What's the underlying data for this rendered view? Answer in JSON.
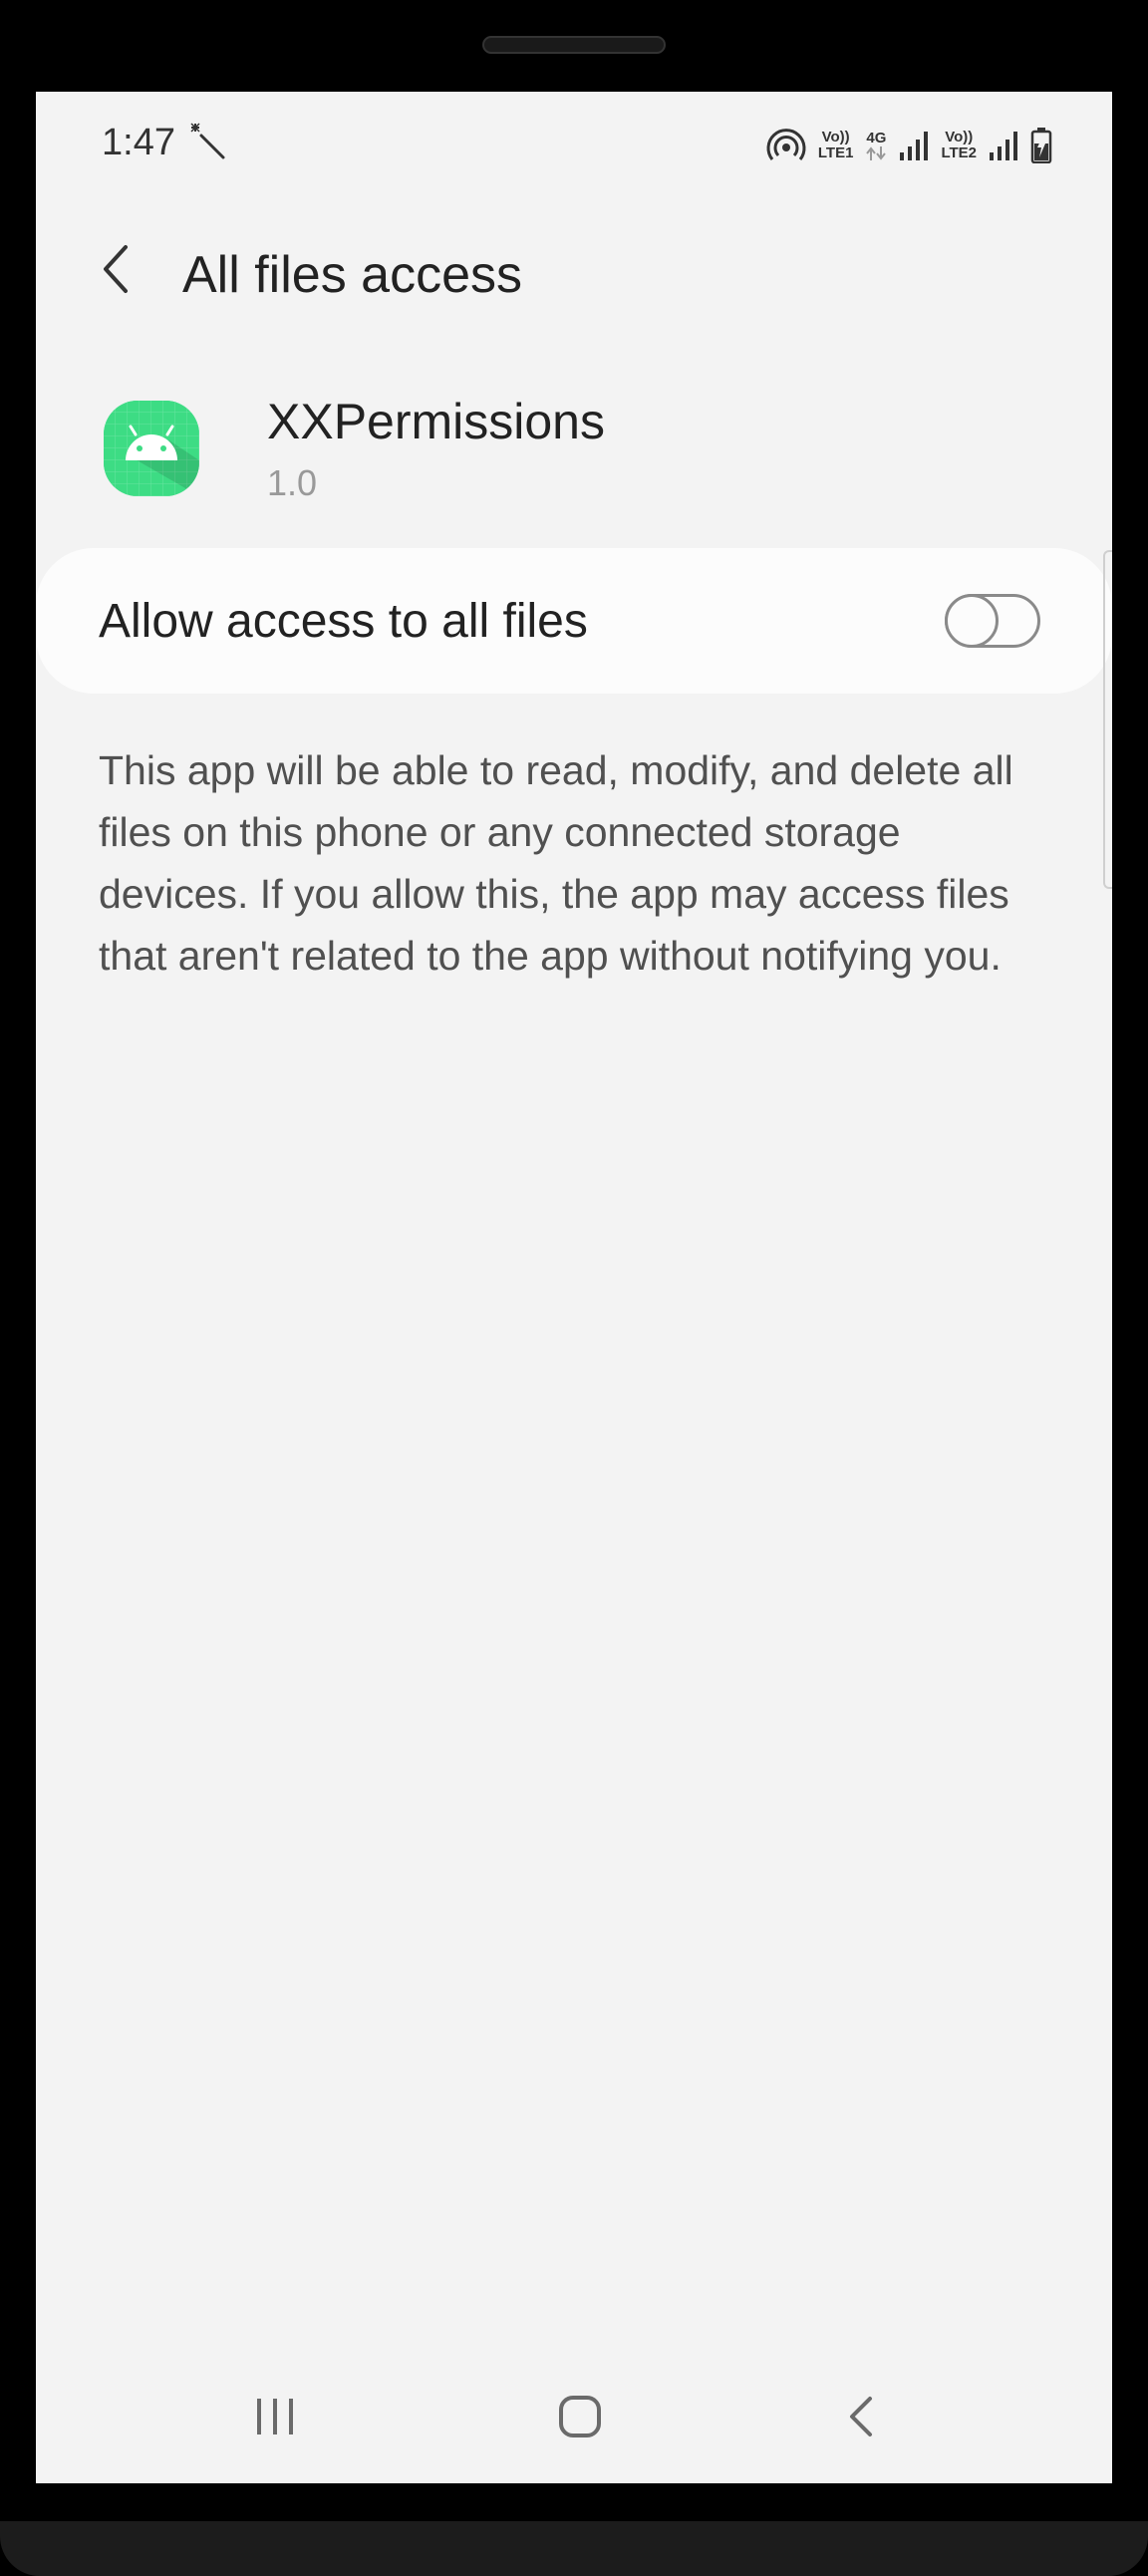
{
  "status_bar": {
    "time": "1:47",
    "lte1_top": "Vo))",
    "lte1_bottom": "LTE1",
    "network_type": "4G",
    "lte2_top": "Vo))",
    "lte2_bottom": "LTE2"
  },
  "header": {
    "title": "All files access"
  },
  "app": {
    "name": "XXPermissions",
    "version": "1.0",
    "icon": "android-robot-icon",
    "icon_color": "#3ddc84"
  },
  "permission": {
    "label": "Allow access to all files",
    "enabled": false
  },
  "description": "This app will be able to read, modify, and delete all files on this phone or any connected storage devices. If you allow this, the app may access files that aren't related to the app without notifying you.",
  "colors": {
    "background": "#f3f3f3",
    "card": "#fcfcfc",
    "text_primary": "#222222",
    "text_secondary": "#505050"
  }
}
